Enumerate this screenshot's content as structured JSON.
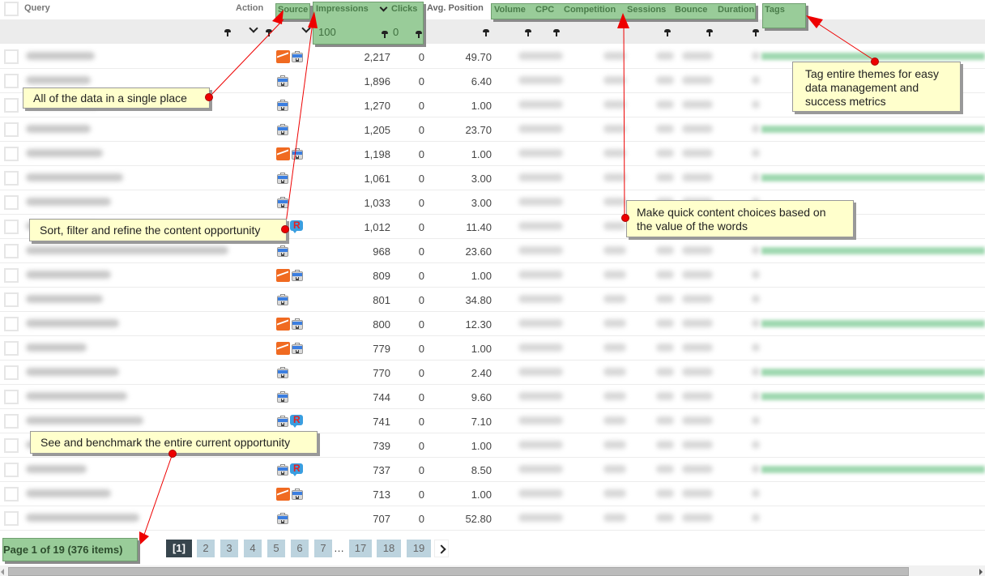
{
  "columns": {
    "query": "Query",
    "action": "Action",
    "source": "Source",
    "impressions": "Impressions",
    "clicks": "Clicks",
    "avg_position": "Avg. Position",
    "volume": "Volume",
    "cpc": "CPC",
    "competition": "Competition",
    "sessions": "Sessions",
    "bounce": "Bounce",
    "duration": "Duration",
    "tags": "Tags"
  },
  "filters": {
    "impressions_value": "100",
    "clicks_value": "0"
  },
  "rows": [
    {
      "impressions": "2,217",
      "clicks": "0",
      "avg_position": "49.70",
      "sources": [
        "analytics-icon",
        "webmaster-tools-icon"
      ],
      "tagged": true
    },
    {
      "impressions": "1,896",
      "clicks": "0",
      "avg_position": "6.40",
      "sources": [
        "webmaster-tools-icon"
      ],
      "tagged": false
    },
    {
      "impressions": "1,270",
      "clicks": "0",
      "avg_position": "1.00",
      "sources": [
        "webmaster-tools-icon"
      ],
      "tagged": false
    },
    {
      "impressions": "1,205",
      "clicks": "0",
      "avg_position": "23.70",
      "sources": [
        "webmaster-tools-icon"
      ],
      "tagged": true
    },
    {
      "impressions": "1,198",
      "clicks": "0",
      "avg_position": "1.00",
      "sources": [
        "analytics-icon",
        "webmaster-tools-icon"
      ],
      "tagged": false
    },
    {
      "impressions": "1,061",
      "clicks": "0",
      "avg_position": "3.00",
      "sources": [
        "webmaster-tools-icon"
      ],
      "tagged": true
    },
    {
      "impressions": "1,033",
      "clicks": "0",
      "avg_position": "3.00",
      "sources": [
        "webmaster-tools-icon"
      ],
      "tagged": false
    },
    {
      "impressions": "1,012",
      "clicks": "0",
      "avg_position": "11.40",
      "sources": [
        "webmaster-tools-icon",
        "rank-icon"
      ],
      "tagged": false
    },
    {
      "impressions": "968",
      "clicks": "0",
      "avg_position": "23.60",
      "sources": [
        "webmaster-tools-icon"
      ],
      "tagged": true
    },
    {
      "impressions": "809",
      "clicks": "0",
      "avg_position": "1.00",
      "sources": [
        "analytics-icon",
        "webmaster-tools-icon"
      ],
      "tagged": false
    },
    {
      "impressions": "801",
      "clicks": "0",
      "avg_position": "34.80",
      "sources": [
        "webmaster-tools-icon"
      ],
      "tagged": false
    },
    {
      "impressions": "800",
      "clicks": "0",
      "avg_position": "12.30",
      "sources": [
        "analytics-icon",
        "webmaster-tools-icon"
      ],
      "tagged": true
    },
    {
      "impressions": "779",
      "clicks": "0",
      "avg_position": "1.00",
      "sources": [
        "analytics-icon",
        "webmaster-tools-icon"
      ],
      "tagged": false
    },
    {
      "impressions": "770",
      "clicks": "0",
      "avg_position": "2.40",
      "sources": [
        "webmaster-tools-icon"
      ],
      "tagged": true
    },
    {
      "impressions": "744",
      "clicks": "0",
      "avg_position": "9.60",
      "sources": [
        "webmaster-tools-icon"
      ],
      "tagged": true
    },
    {
      "impressions": "741",
      "clicks": "0",
      "avg_position": "7.10",
      "sources": [
        "webmaster-tools-icon",
        "rank-icon"
      ],
      "tagged": false
    },
    {
      "impressions": "739",
      "clicks": "0",
      "avg_position": "1.00",
      "sources": [],
      "tagged": false
    },
    {
      "impressions": "737",
      "clicks": "0",
      "avg_position": "8.50",
      "sources": [
        "webmaster-tools-icon",
        "rank-icon"
      ],
      "tagged": true
    },
    {
      "impressions": "713",
      "clicks": "0",
      "avg_position": "1.00",
      "sources": [
        "analytics-icon",
        "webmaster-tools-icon"
      ],
      "tagged": false
    },
    {
      "impressions": "707",
      "clicks": "0",
      "avg_position": "52.80",
      "sources": [
        "webmaster-tools-icon"
      ],
      "tagged": false
    }
  ],
  "annotations": {
    "single_place": "All of the data in a single place",
    "sort_filter": "Sort, filter and refine the content opportunity",
    "benchmark": "See and benchmark the entire current opportunity",
    "content_choices": "Make quick content choices based on the value of the words",
    "tag_themes": "Tag entire themes for easy data management and success metrics"
  },
  "pagination": {
    "info": "Page 1 of 19 (376 items)",
    "pages": [
      "[1]",
      "2",
      "3",
      "4",
      "5",
      "6",
      "7",
      "17",
      "18",
      "19"
    ],
    "ellipsis": "…",
    "active_page": "[1]"
  }
}
